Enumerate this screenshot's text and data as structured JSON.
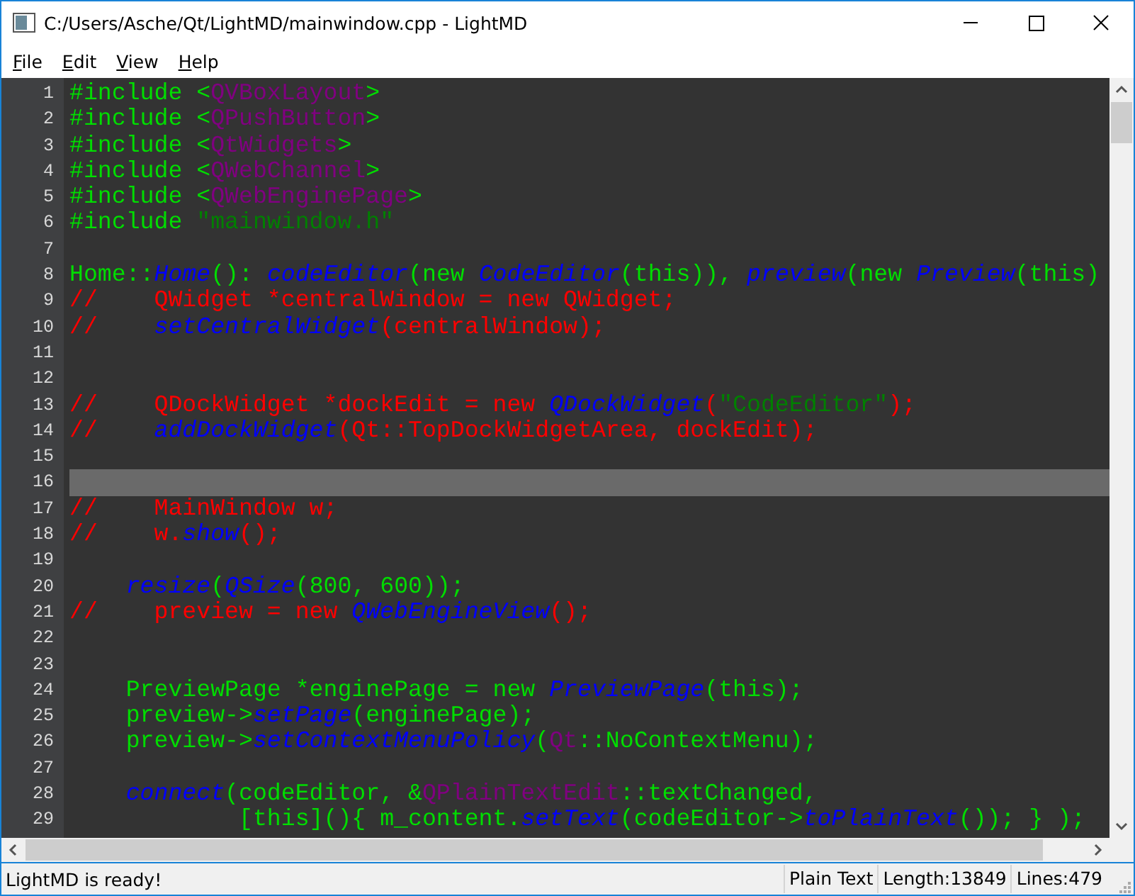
{
  "window": {
    "title": "C:/Users/Asche/Qt/LightMD/mainwindow.cpp - LightMD"
  },
  "menu": [
    {
      "label": "F",
      "rest": "ile"
    },
    {
      "label": "E",
      "rest": "dit"
    },
    {
      "label": "V",
      "rest": "iew"
    },
    {
      "label": "H",
      "rest": "elp"
    }
  ],
  "editor": {
    "lines": [
      {
        "number": "1",
        "current": false,
        "tokens": [
          {
            "text": "#include <",
            "kind": "code"
          },
          {
            "text": "QVBoxLayout",
            "kind": "type"
          },
          {
            "text": ">",
            "kind": "code"
          }
        ]
      },
      {
        "number": "2",
        "current": false,
        "tokens": [
          {
            "text": "#include <",
            "kind": "code"
          },
          {
            "text": "QPushButton",
            "kind": "type"
          },
          {
            "text": ">",
            "kind": "code"
          }
        ]
      },
      {
        "number": "3",
        "current": false,
        "tokens": [
          {
            "text": "#include <",
            "kind": "code"
          },
          {
            "text": "QtWidgets",
            "kind": "type"
          },
          {
            "text": ">",
            "kind": "code"
          }
        ]
      },
      {
        "number": "4",
        "current": false,
        "tokens": [
          {
            "text": "#include <",
            "kind": "code"
          },
          {
            "text": "QWebChannel",
            "kind": "type"
          },
          {
            "text": ">",
            "kind": "code"
          }
        ]
      },
      {
        "number": "5",
        "current": false,
        "tokens": [
          {
            "text": "#include <",
            "kind": "code"
          },
          {
            "text": "QWebEnginePage",
            "kind": "type"
          },
          {
            "text": ">",
            "kind": "code"
          }
        ]
      },
      {
        "number": "6",
        "current": false,
        "tokens": [
          {
            "text": "#include ",
            "kind": "code"
          },
          {
            "text": "\"mainwindow.h\"",
            "kind": "string"
          }
        ]
      },
      {
        "number": "7",
        "current": false
      },
      {
        "number": "8",
        "current": false,
        "tokens": [
          {
            "text": "Home::",
            "kind": "code"
          },
          {
            "text": "Home",
            "kind": "func"
          },
          {
            "text": "(): ",
            "kind": "code"
          },
          {
            "text": "codeEditor",
            "kind": "func"
          },
          {
            "text": "(new ",
            "kind": "code"
          },
          {
            "text": "CodeEditor",
            "kind": "func"
          },
          {
            "text": "(this)), ",
            "kind": "code"
          },
          {
            "text": "preview",
            "kind": "func"
          },
          {
            "text": "(new ",
            "kind": "code"
          },
          {
            "text": "Preview",
            "kind": "func"
          },
          {
            "text": "(this)",
            "kind": "code"
          }
        ]
      },
      {
        "number": "9",
        "current": false,
        "tokens": [
          {
            "text": "//    QWidget *centralWindow = new QWidget;",
            "kind": "comment"
          }
        ]
      },
      {
        "number": "10",
        "current": false,
        "tokens": [
          {
            "text": "//    ",
            "kind": "comment"
          },
          {
            "text": "setCentralWidget",
            "kind": "func"
          },
          {
            "text": "(centralWindow);",
            "kind": "comment"
          }
        ]
      },
      {
        "number": "11",
        "current": false
      },
      {
        "number": "12",
        "current": false
      },
      {
        "number": "13",
        "current": false,
        "tokens": [
          {
            "text": "//    QDockWidget *dockEdit = new ",
            "kind": "comment"
          },
          {
            "text": "QDockWidget",
            "kind": "func"
          },
          {
            "text": "(",
            "kind": "comment"
          },
          {
            "text": "\"CodeEditor\"",
            "kind": "string"
          },
          {
            "text": ");",
            "kind": "comment"
          }
        ]
      },
      {
        "number": "14",
        "current": false,
        "tokens": [
          {
            "text": "//    ",
            "kind": "comment"
          },
          {
            "text": "addDockWidget",
            "kind": "func"
          },
          {
            "text": "(Qt::TopDockWidgetArea, dockEdit);",
            "kind": "comment"
          }
        ]
      },
      {
        "number": "15",
        "current": false
      },
      {
        "number": "16",
        "current": true
      },
      {
        "number": "17",
        "current": false,
        "tokens": [
          {
            "text": "//    MainWindow w;",
            "kind": "comment"
          }
        ]
      },
      {
        "number": "18",
        "current": false,
        "tokens": [
          {
            "text": "//    w.",
            "kind": "comment"
          },
          {
            "text": "show",
            "kind": "func"
          },
          {
            "text": "();",
            "kind": "comment"
          }
        ]
      },
      {
        "number": "19",
        "current": false
      },
      {
        "number": "20",
        "current": false,
        "tokens": [
          {
            "text": "    resize",
            "kind": "func"
          },
          {
            "text": "(",
            "kind": "code"
          },
          {
            "text": "QSize",
            "kind": "func"
          },
          {
            "text": "(800, 600));",
            "kind": "code"
          }
        ]
      },
      {
        "number": "21",
        "current": false,
        "tokens": [
          {
            "text": "//    preview = new ",
            "kind": "comment"
          },
          {
            "text": "QWebEngineView",
            "kind": "func"
          },
          {
            "text": "();",
            "kind": "comment"
          }
        ]
      },
      {
        "number": "22",
        "current": false
      },
      {
        "number": "23",
        "current": false
      },
      {
        "number": "24",
        "current": false,
        "tokens": [
          {
            "text": "    PreviewPage *enginePage = new ",
            "kind": "code"
          },
          {
            "text": "PreviewPage",
            "kind": "func"
          },
          {
            "text": "(this);",
            "kind": "code"
          }
        ]
      },
      {
        "number": "25",
        "current": false,
        "tokens": [
          {
            "text": "    preview->",
            "kind": "code"
          },
          {
            "text": "setPage",
            "kind": "func"
          },
          {
            "text": "(enginePage);",
            "kind": "code"
          }
        ]
      },
      {
        "number": "26",
        "current": false,
        "tokens": [
          {
            "text": "    preview->",
            "kind": "code"
          },
          {
            "text": "setContextMenuPolicy",
            "kind": "func"
          },
          {
            "text": "(",
            "kind": "code"
          },
          {
            "text": "Qt",
            "kind": "type"
          },
          {
            "text": "::NoContextMenu);",
            "kind": "code"
          }
        ]
      },
      {
        "number": "27",
        "current": false
      },
      {
        "number": "28",
        "current": false,
        "tokens": [
          {
            "text": "    connect",
            "kind": "func"
          },
          {
            "text": "(codeEditor, &",
            "kind": "code"
          },
          {
            "text": "QPlainTextEdit",
            "kind": "type"
          },
          {
            "text": "::textChanged,",
            "kind": "code"
          }
        ]
      },
      {
        "number": "29",
        "current": false,
        "tokens": [
          {
            "text": "            [this](){ m_content.",
            "kind": "code"
          },
          {
            "text": "setText",
            "kind": "func"
          },
          {
            "text": "(codeEditor->",
            "kind": "code"
          },
          {
            "text": "toPlainText",
            "kind": "func"
          },
          {
            "text": "()); } );",
            "kind": "code"
          }
        ]
      }
    ]
  },
  "status_bar": {
    "message": "LightMD is ready!",
    "sections": [
      "Plain Text",
      "Length:13849",
      "Lines:479"
    ]
  }
}
